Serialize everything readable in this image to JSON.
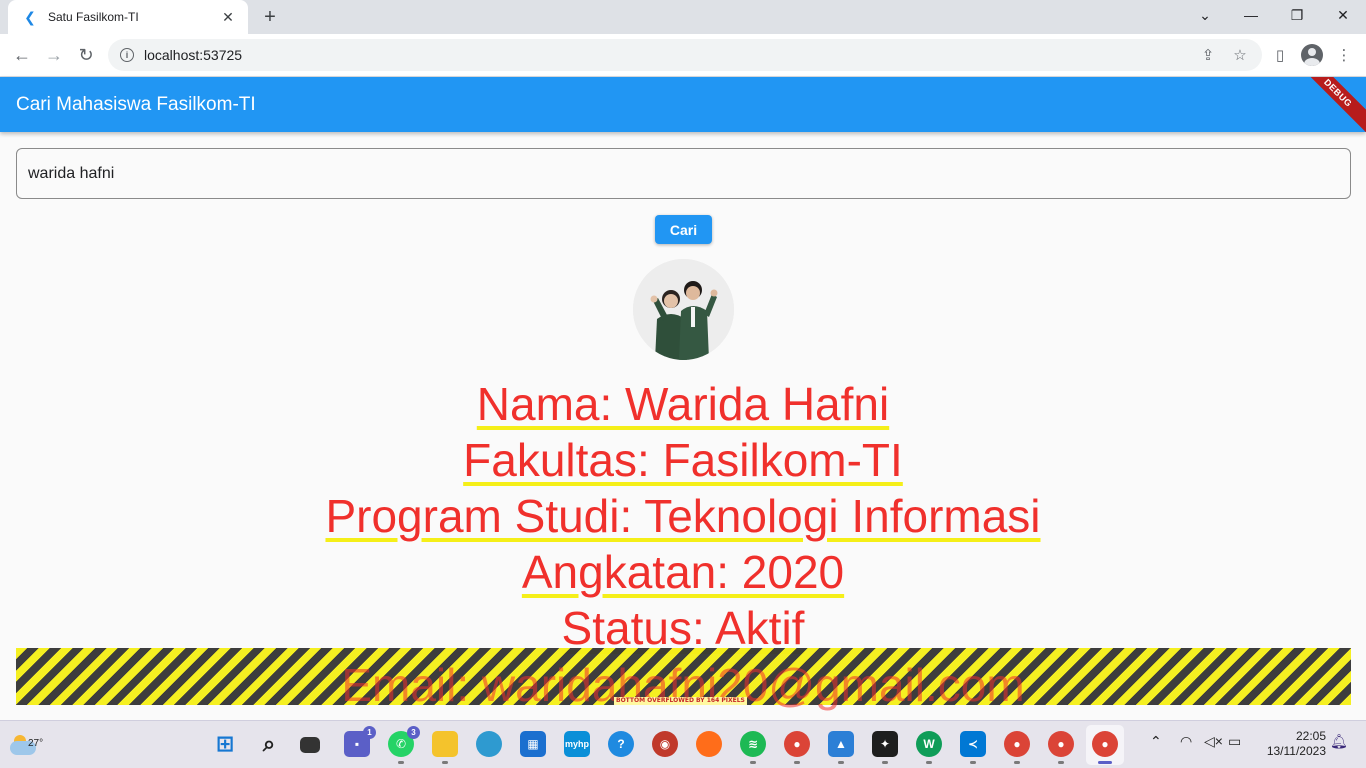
{
  "browser": {
    "tab_title": "Satu Fasilkom-TI",
    "tab_close": "✕",
    "new_tab": "+",
    "url": "localhost:53725"
  },
  "app": {
    "title": "Cari Mahasiswa Fasilkom-TI",
    "debug_banner": "DEBUG"
  },
  "search": {
    "value": "warida hafni",
    "button_label": "Cari"
  },
  "student": {
    "nama": "Nama: Warida Hafni",
    "fakultas": "Fakultas: Fasilkom-TI",
    "prodi": "Program Studi: Teknologi Informasi",
    "angkatan": "Angkatan: 2020",
    "status": "Status: Aktif",
    "email": "Email: waridahafni20@gmail.com"
  },
  "overflow_warning": "BOTTOM OVERFLOWED BY 164 PIXELS",
  "taskbar": {
    "weather_temp": "27°",
    "teams_badge": "1",
    "whatsapp_badge": "3",
    "time": "22:05",
    "date": "13/11/2023"
  },
  "colors": {
    "app_bar": "#2196f3",
    "text_red": "#f0302c",
    "underline_yellow": "#f5ef18"
  }
}
